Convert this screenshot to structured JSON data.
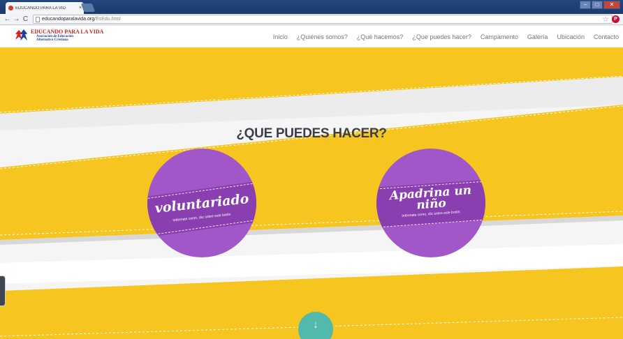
{
  "browser": {
    "tab_title": "EDUCANDO PARA LA VID",
    "tab_close": "×",
    "url_host": "educandoparalavida.org",
    "url_path": "/EsEdu.html",
    "back": "←",
    "forward": "→",
    "reload": "C",
    "bookmark_star": "☆",
    "extension_label": "P",
    "window_buttons": [
      "–",
      "□",
      "✕"
    ]
  },
  "site": {
    "logo_name": "EDUCANDO PARA LA VIDA",
    "logo_sub1": "Asociación de Educación",
    "logo_sub2": "Alternativa Cristiana",
    "nav": [
      "Inicio",
      "¿Quiénes somos?",
      "¿Qué hacemos?",
      "¿Que puedes hacer?",
      "Campamento",
      "Galería",
      "Ubicación",
      "Contacto"
    ]
  },
  "section": {
    "title": "¿QUE PUEDES HACER?"
  },
  "cards": [
    {
      "title": "voluntariado",
      "hint": "Infórmate como, clic sobre este botón"
    },
    {
      "title": "Apadrina un niño",
      "hint": "Infórmate como, clic sobre este botón"
    }
  ],
  "scroll_button": {
    "icon": "↓"
  },
  "colors": {
    "yellow": "#f6c520",
    "purple": "#a257c8",
    "purple_dark": "#8a3fb0",
    "teal": "#52b9ab",
    "title": "#3a3f47"
  },
  "icons": [
    "favicon-icon",
    "doc-icon",
    "star-icon",
    "extension-icon",
    "logo-icon",
    "down-arrow-icon"
  ]
}
